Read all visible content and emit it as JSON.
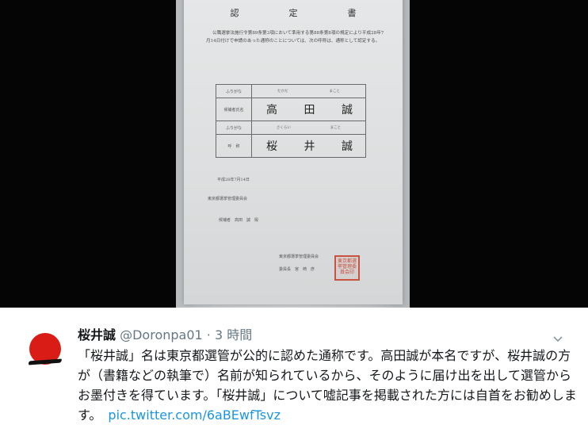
{
  "document": {
    "title": "認　定　書",
    "body": "公職選挙法施行令第89条第3項において準用する第88条第8項の規定により平成28年7月14日付けで申請のあった通称のことについては、次の呼称は、通称として認定する。",
    "table": {
      "row1_label": "ふりがな",
      "row1_values": [
        "たかだ",
        "まこと"
      ],
      "row2_label": "候補者氏名",
      "row2_values": [
        "高",
        "田",
        "誠"
      ],
      "row3_label": "ふりがな",
      "row3_values": [
        "さくらい",
        "まこと"
      ],
      "row4_label": "呼　称",
      "row4_values": [
        "桜",
        "井",
        "誠"
      ]
    },
    "date": "平成28年7月14日",
    "committee": "東京都選挙管理委員会",
    "candidate": "候補者　高田　誠　殿",
    "committee2": "東京都選挙管理委員会",
    "chair": "委員長　宮　崎　彦",
    "seal": "東京都選挙管理委員会印"
  },
  "tweet": {
    "name": "桜井誠",
    "handle": "@Doronpa01",
    "separator": "·",
    "time": "3 時間",
    "text": "「桜井誠」名は東京都選管が公的に認めた通称です。高田誠が本名ですが、桜井誠の方が（書籍などの執筆で）名前が知られているから、そのように届け出を出して選管からお墨付きを得ています。「桜井誠」について嘘記事を掲載された方には自首をお勧めします。",
    "link": "pic.twitter.com/6aBEwfTsvz",
    "colors": {
      "text": "#14171a",
      "meta": "#657786",
      "link": "#1b95e0"
    }
  },
  "icons": {
    "avatar": "rising-sun-avatar",
    "caret": "chevron-down-icon"
  }
}
